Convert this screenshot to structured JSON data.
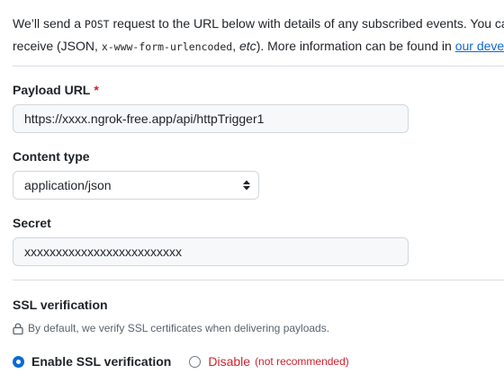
{
  "intro": {
    "line1_before": "We’ll send a ",
    "line1_code": "POST",
    "line1_after": " request to the URL below with details of any subscribed events. You can also specify which data format you’d like to",
    "line2_before": "receive (JSON, ",
    "line2_code": "x-www-form-urlencoded",
    "line2_sep": ", ",
    "line2_etc": "etc",
    "line2_after": "). More information can be found in ",
    "line2_link": "our developer documentation"
  },
  "payload_url": {
    "label": "Payload URL",
    "required_mark": "*",
    "value": "https://xxxx.ngrok-free.app/api/httpTrigger1"
  },
  "content_type": {
    "label": "Content type",
    "selected": "application/json"
  },
  "secret": {
    "label": "Secret",
    "value": "xxxxxxxxxxxxxxxxxxxxxxxxx"
  },
  "ssl": {
    "label": "SSL verification",
    "note": "By default, we verify SSL certificates when delivering payloads.",
    "enable_label": "Enable SSL verification",
    "enable_checked": true,
    "disable_label": "Disable",
    "disable_note": "(not recommended)"
  },
  "icons": {
    "lock": "lock-icon",
    "select_arrows": "chevron-up-down-icon"
  },
  "colors": {
    "accent": "#0969da",
    "danger": "#cf222e",
    "muted": "#59636e",
    "border": "#d0d7de"
  }
}
